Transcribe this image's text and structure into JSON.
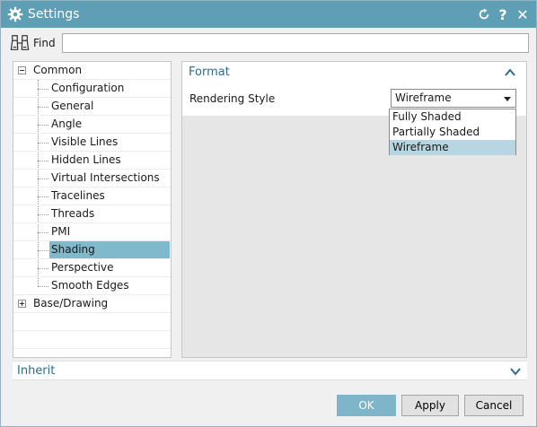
{
  "window": {
    "title": "Settings"
  },
  "titlebar": {
    "icons": {
      "app": "gear-icon",
      "reset": "reset-icon",
      "help": "help-icon",
      "close": "close-icon"
    },
    "help_glyph": "?",
    "close_glyph": "✕"
  },
  "find": {
    "label": "Find",
    "value": "",
    "placeholder": ""
  },
  "tree": {
    "items": [
      {
        "label": "Common",
        "level": 0,
        "expanded": true
      },
      {
        "label": "Configuration",
        "level": 1
      },
      {
        "label": "General",
        "level": 1
      },
      {
        "label": "Angle",
        "level": 1
      },
      {
        "label": "Visible Lines",
        "level": 1
      },
      {
        "label": "Hidden Lines",
        "level": 1
      },
      {
        "label": "Virtual Intersections",
        "level": 1
      },
      {
        "label": "Tracelines",
        "level": 1
      },
      {
        "label": "Threads",
        "level": 1
      },
      {
        "label": "PMI",
        "level": 1
      },
      {
        "label": "Shading",
        "level": 1,
        "selected": true
      },
      {
        "label": "Perspective",
        "level": 1
      },
      {
        "label": "Smooth Edges",
        "level": 1
      },
      {
        "label": "Base/Drawing",
        "level": 0,
        "expanded": false
      }
    ]
  },
  "format": {
    "title": "Format",
    "rendering_style": {
      "label": "Rendering Style",
      "value": "Wireframe",
      "options": [
        "Fully Shaded",
        "Partially Shaded",
        "Wireframe"
      ]
    }
  },
  "inherit": {
    "title": "Inherit"
  },
  "buttons": {
    "ok": "OK",
    "apply": "Apply",
    "cancel": "Cancel"
  },
  "colors": {
    "titlebar": "#5e9fb6",
    "accent_text": "#2c6c8a",
    "selection": "#80b9cc",
    "ok_button": "#7fb5c8"
  }
}
